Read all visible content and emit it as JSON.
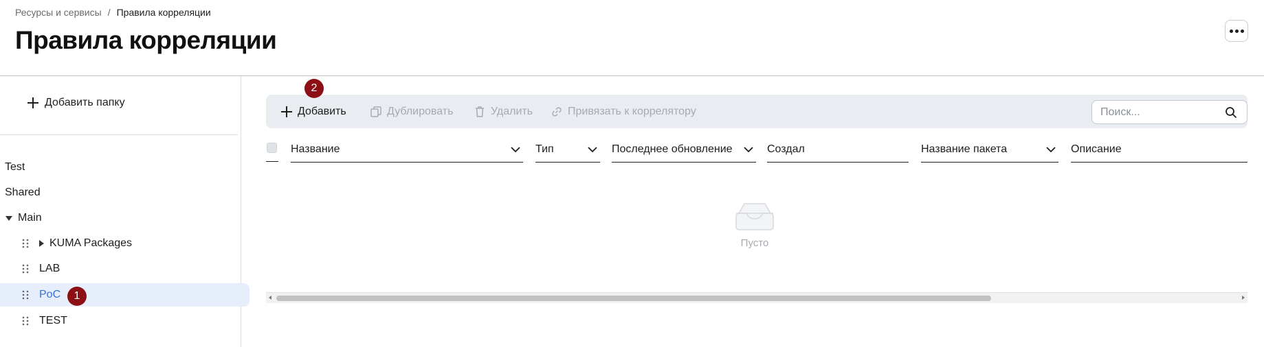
{
  "breadcrumb": {
    "parent": "Ресурсы и сервисы",
    "separator": "/",
    "current": "Правила корреляции"
  },
  "page_title": "Правила корреляции",
  "sidebar": {
    "add_folder_label": "Добавить папку",
    "items": [
      {
        "label": "Test"
      },
      {
        "label": "Shared"
      },
      {
        "label": "Main",
        "expanded": true
      },
      {
        "label": "KUMA Packages",
        "expandable": true
      },
      {
        "label": "LAB"
      },
      {
        "label": "PoC",
        "selected": true
      },
      {
        "label": "TEST"
      }
    ]
  },
  "annotations": {
    "badge_1": "1",
    "badge_2": "2"
  },
  "toolbar": {
    "add_label": "Добавить",
    "duplicate_label": "Дублировать",
    "delete_label": "Удалить",
    "bind_label": "Привязать к коррелятору"
  },
  "search": {
    "placeholder": "Поиск...",
    "value": ""
  },
  "table": {
    "columns": [
      "Название",
      "Тип",
      "Последнее обновление",
      "Создал",
      "Название пакета",
      "Описание"
    ],
    "empty_text": "Пусто"
  },
  "colors": {
    "accent": "#3a6fd8",
    "badge": "#8b0f14",
    "toolbar_bg": "#e9ecf0",
    "selected_bg": "#e6eefc"
  }
}
